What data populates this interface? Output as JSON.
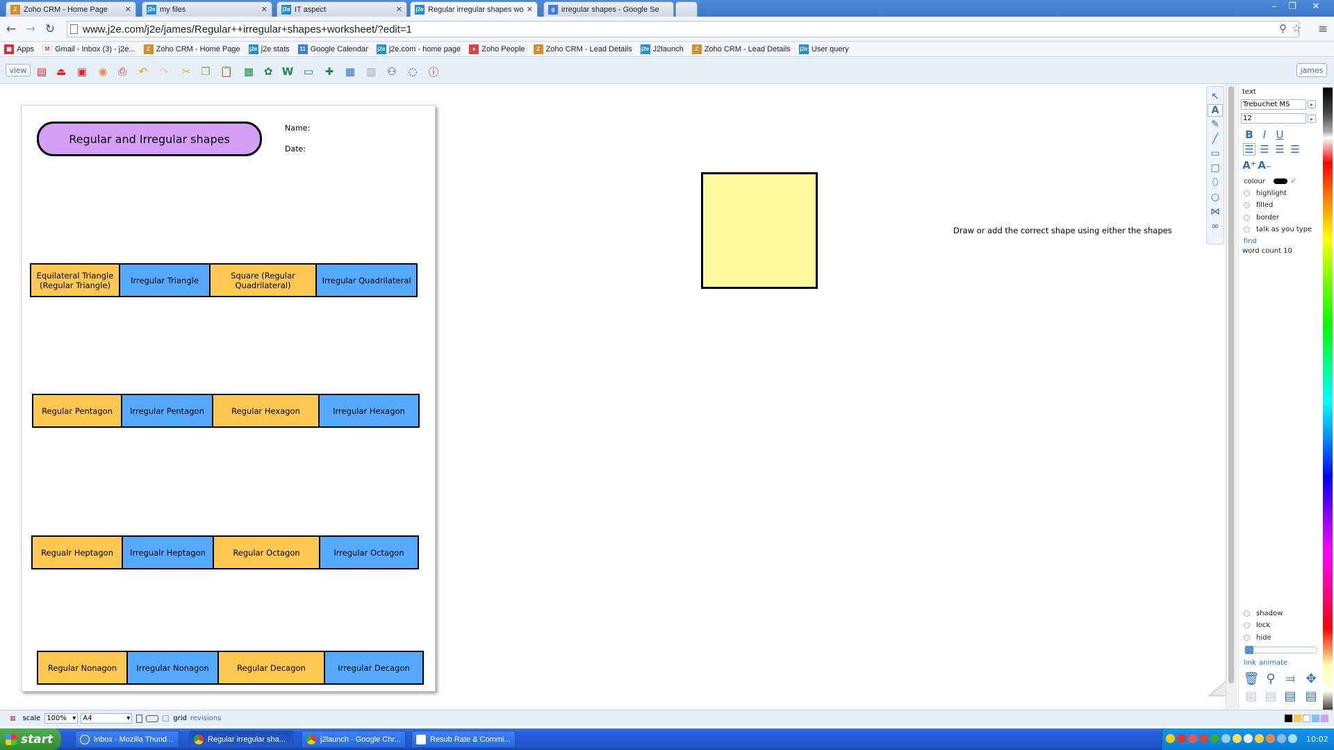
{
  "browser": {
    "tabs": [
      {
        "label": "Zoho CRM - Home Page",
        "icon": "zoho-icon"
      },
      {
        "label": "my files",
        "icon": "j2e-icon"
      },
      {
        "label": "IT aspect",
        "icon": "j2e-icon"
      },
      {
        "label": "Regular irregular shapes wor",
        "icon": "j2e-icon",
        "active": true
      },
      {
        "label": "irregular shapes - Google Se",
        "icon": "google-icon"
      }
    ],
    "url": "www.j2e.com/j2e/james/Regular++irregular+shapes+worksheet/?edit=1",
    "bookmarks": [
      {
        "label": "Apps"
      },
      {
        "label": "Gmail - Inbox (3) - j2e..."
      },
      {
        "label": "Zoho CRM - Home Page"
      },
      {
        "label": "j2e stats"
      },
      {
        "label": "Google Calendar"
      },
      {
        "label": "j2e.com - home page"
      },
      {
        "label": "Zoho People"
      },
      {
        "label": "Zoho CRM - Lead Details"
      },
      {
        "label": "J2launch"
      },
      {
        "label": "Zoho CRM - Lead Details"
      },
      {
        "label": "User query"
      }
    ]
  },
  "toolbar": {
    "view_label": "view",
    "user_label": "james"
  },
  "worksheet": {
    "title": "Regular and Irregular shapes",
    "name_label": "Name:",
    "date_label": "Date:",
    "rows": [
      [
        "Equilateral Triangle (Regular Triangle)",
        "Irregular Triangle",
        "Square (Regular Quadrilateral)",
        "Irregular Quadrilateral"
      ],
      [
        "Regular Pentagon",
        "Irregular Pentagon",
        "Regular Hexagon",
        "Irregular Hexagon"
      ],
      [
        "Regualr Heptagon",
        "Irregualr Heptagon",
        "Regular Octagon",
        "Irregular Octagon"
      ],
      [
        "Regular Nonagon",
        "Irregular Nonagon",
        "Regular Decagon",
        "Irregular Decagon"
      ]
    ],
    "instruction": "Draw or add the correct shape using either the shapes"
  },
  "side_panel": {
    "section_label": "text",
    "font_value": "Trebuchet MS",
    "size_value": "12",
    "colour_label": "colour",
    "checkboxes": [
      "highlight",
      "filled",
      "border",
      "talk as you type"
    ],
    "find_label": "find",
    "word_count": "word count 10",
    "bottom_checkboxes": [
      "shadow",
      "lock",
      "hide"
    ],
    "link_label": "link",
    "animate_label": "animate"
  },
  "statusbar": {
    "scale_label": "scale",
    "scale_value": "100%",
    "page_size": "A4",
    "grid_label": "grid",
    "revisions_label": "revisions"
  },
  "taskbar": {
    "start_label": "start",
    "tasks": [
      {
        "label": "Inbox - Mozilla Thund..."
      },
      {
        "label": "Regular irregular sha..."
      },
      {
        "label": "j2launch - Google Chr..."
      },
      {
        "label": "Resub Rate & Commi..."
      }
    ],
    "clock": "10:02"
  },
  "colors": {
    "title_fill": "#d69ff7",
    "cell_yellow": "#fec850",
    "cell_blue": "#55aaff",
    "square_fill": "#fef99d"
  }
}
